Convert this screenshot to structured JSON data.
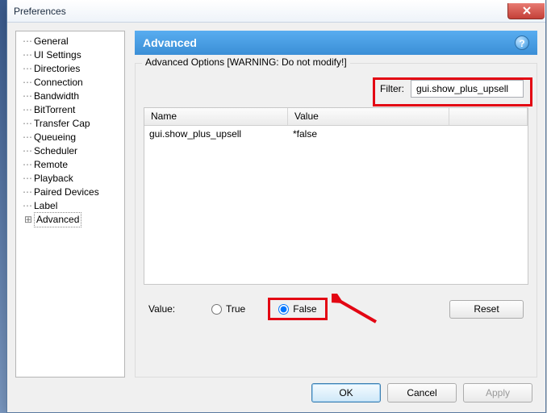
{
  "window": {
    "title": "Preferences",
    "close_label": "Close"
  },
  "tree": {
    "items": [
      {
        "label": "General",
        "key": "general"
      },
      {
        "label": "UI Settings",
        "key": "ui-settings"
      },
      {
        "label": "Directories",
        "key": "directories"
      },
      {
        "label": "Connection",
        "key": "connection"
      },
      {
        "label": "Bandwidth",
        "key": "bandwidth"
      },
      {
        "label": "BitTorrent",
        "key": "bittorrent"
      },
      {
        "label": "Transfer Cap",
        "key": "transfer-cap"
      },
      {
        "label": "Queueing",
        "key": "queueing"
      },
      {
        "label": "Scheduler",
        "key": "scheduler"
      },
      {
        "label": "Remote",
        "key": "remote"
      },
      {
        "label": "Playback",
        "key": "playback"
      },
      {
        "label": "Paired Devices",
        "key": "paired-devices"
      },
      {
        "label": "Label",
        "key": "label"
      },
      {
        "label": "Advanced",
        "key": "advanced",
        "expandable": true,
        "selected": true
      }
    ]
  },
  "panel": {
    "title": "Advanced",
    "help_icon": "?",
    "legend": "Advanced Options [WARNING: Do not modify!]",
    "filter_label": "Filter:",
    "filter_value": "gui.show_plus_upsell",
    "columns": {
      "name": "Name",
      "value": "Value"
    },
    "rows": [
      {
        "name": "gui.show_plus_upsell",
        "value": "*false"
      }
    ],
    "value_label": "Value:",
    "radio_true": "True",
    "radio_false": "False",
    "radio_selected": "false",
    "reset_label": "Reset"
  },
  "buttons": {
    "ok": "OK",
    "cancel": "Cancel",
    "apply": "Apply"
  },
  "annotations": {
    "filter_highlight": true,
    "false_highlight": true,
    "arrow_to_false": true
  },
  "colors": {
    "accent": "#3b8fd6",
    "highlight": "#e30613"
  }
}
